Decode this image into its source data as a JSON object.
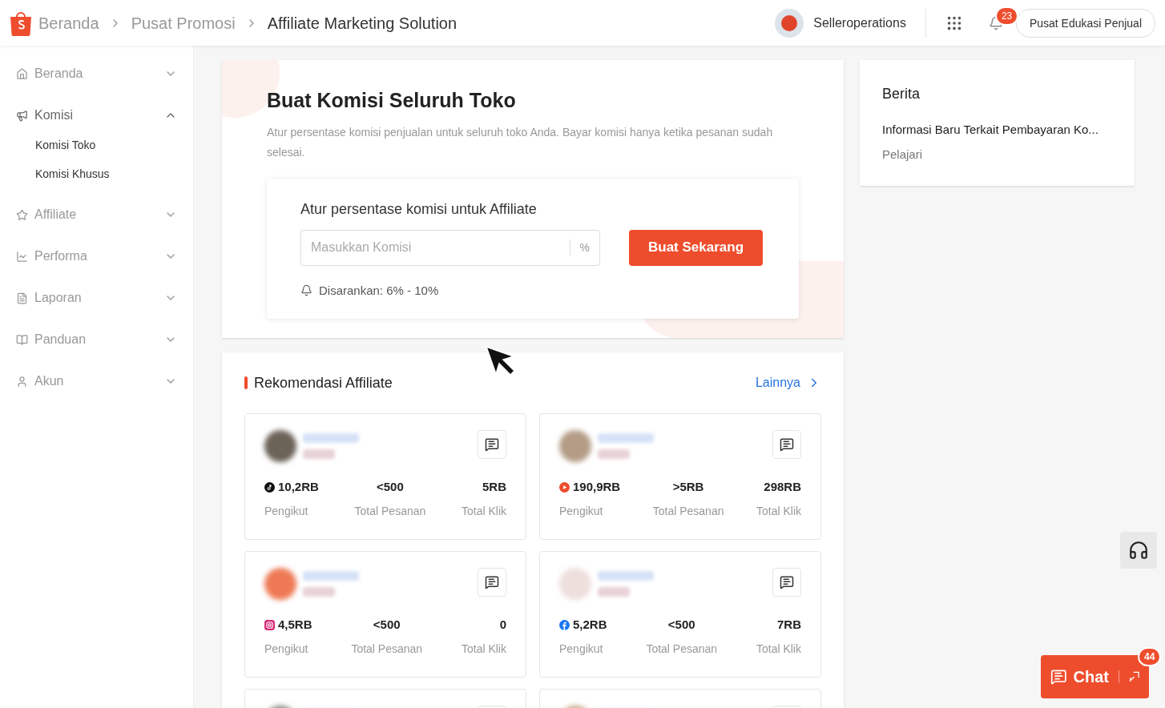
{
  "breadcrumb": [
    {
      "label": "Beranda",
      "kind": "link"
    },
    {
      "label": "Pusat Promosi",
      "kind": "link"
    },
    {
      "label": "Affiliate Marketing Solution",
      "kind": "current"
    }
  ],
  "header": {
    "user": "Selleroperations",
    "notifications": "23",
    "edu_button": "Pusat Edukasi Penjual"
  },
  "sidebar": [
    {
      "label": "Beranda",
      "expanded": false
    },
    {
      "label": "Komisi",
      "expanded": true,
      "children": [
        {
          "label": "Komisi Toko"
        },
        {
          "label": "Komisi Khusus"
        }
      ]
    },
    {
      "label": "Affiliate",
      "expanded": false
    },
    {
      "label": "Performa",
      "expanded": false
    },
    {
      "label": "Laporan",
      "expanded": false
    },
    {
      "label": "Panduan",
      "expanded": false
    },
    {
      "label": "Akun",
      "expanded": false
    }
  ],
  "commission": {
    "title": "Buat Komisi Seluruh Toko",
    "description": "Atur persentase komisi penjualan untuk seluruh toko Anda. Bayar komisi hanya ketika pesanan sudah selesai.",
    "form_label": "Atur persentase komisi untuk Affiliate",
    "placeholder": "Masukkan Komisi",
    "unit": "%",
    "button": "Buat Sekarang",
    "hint": "Disarankan: 6% - 10%"
  },
  "recommendations": {
    "title": "Rekomendasi Affiliate",
    "more": "Lainnya",
    "cards": [
      {
        "kind": "tiktok",
        "stats": [
          {
            "value": "10,2RB",
            "label": "Pengikut"
          },
          {
            "value": "<500",
            "label": "Total Pesanan"
          },
          {
            "value": "5RB",
            "label": "Total Klik"
          }
        ]
      },
      {
        "kind": "youtube",
        "stats": [
          {
            "value": "190,9RB",
            "label": "Pengikut"
          },
          {
            "value": ">5RB",
            "label": "Total Pesanan"
          },
          {
            "value": "298RB",
            "label": "Total Klik"
          }
        ]
      },
      {
        "kind": "instagram",
        "stats": [
          {
            "value": "4,5RB",
            "label": "Pengikut"
          },
          {
            "value": "<500",
            "label": "Total Pesanan"
          },
          {
            "value": "0",
            "label": "Total Klik"
          }
        ]
      },
      {
        "kind": "facebook",
        "stats": [
          {
            "value": "5,2RB",
            "label": "Pengikut"
          },
          {
            "value": "<500",
            "label": "Total Pesanan"
          },
          {
            "value": "7RB",
            "label": "Total Klik"
          }
        ]
      },
      {
        "kind": "cropped"
      },
      {
        "kind": "cropped"
      }
    ]
  },
  "news": {
    "title": "Berita",
    "items": [
      {
        "headline": "Informasi Baru Terkait Pembayaran Ko...",
        "link": "Pelajari"
      }
    ]
  },
  "chat": {
    "label": "Chat",
    "badge": "44"
  }
}
